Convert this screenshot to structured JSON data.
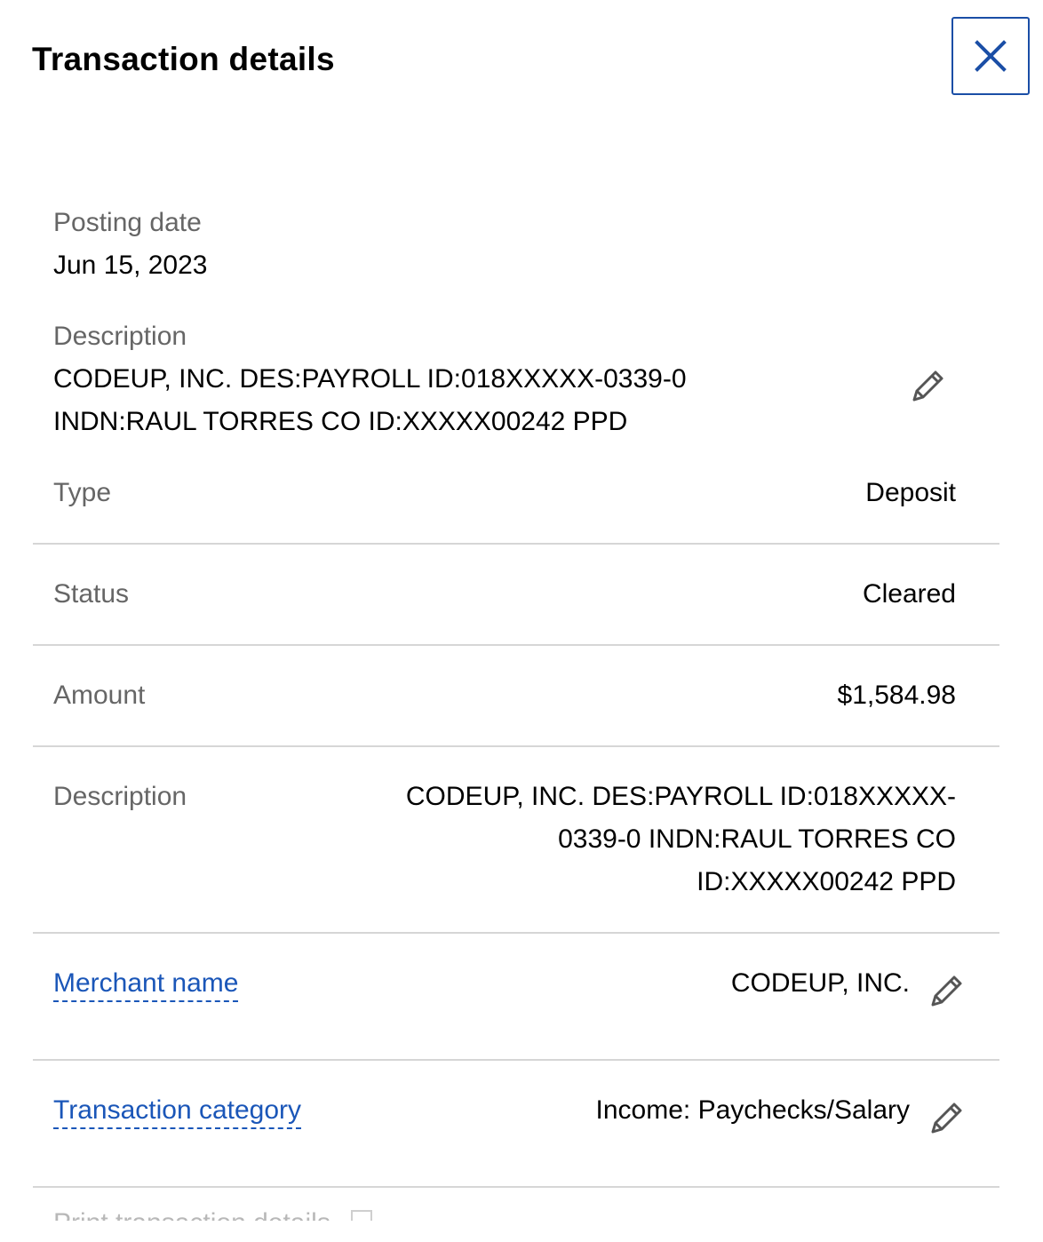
{
  "header": {
    "title": "Transaction details",
    "close_icon": "close-icon"
  },
  "summary": {
    "posting_date_label": "Posting date",
    "posting_date_value": "Jun 15, 2023",
    "description_label": "Description",
    "description_line1": "CODEUP, INC. DES:PAYROLL ID:018XXXXX-0339-0",
    "description_line2": "INDN:RAUL TORRES CO ID:XXXXX00242 PPD",
    "edit_icon": "pencil-icon"
  },
  "details": {
    "type_label": "Type",
    "type_value": "Deposit",
    "status_label": "Status",
    "status_value": "Cleared",
    "amount_label": "Amount",
    "amount_value": "$1,584.98",
    "description_label": "Description",
    "description_line1": "CODEUP, INC. DES:PAYROLL ID:018XXXXX-",
    "description_line2": "0339-0 INDN:RAUL TORRES CO",
    "description_line3": "ID:XXXXX00242 PPD",
    "merchant_label": "Merchant name",
    "merchant_value": "CODEUP, INC.",
    "category_label": "Transaction category",
    "category_value": "Income: Paychecks/Salary"
  },
  "footer": {
    "print_label": "Print transaction details"
  },
  "colors": {
    "link": "#1a56b8",
    "close_border": "#1a4ea6",
    "label": "#666666",
    "divider": "#d6d6d6"
  }
}
